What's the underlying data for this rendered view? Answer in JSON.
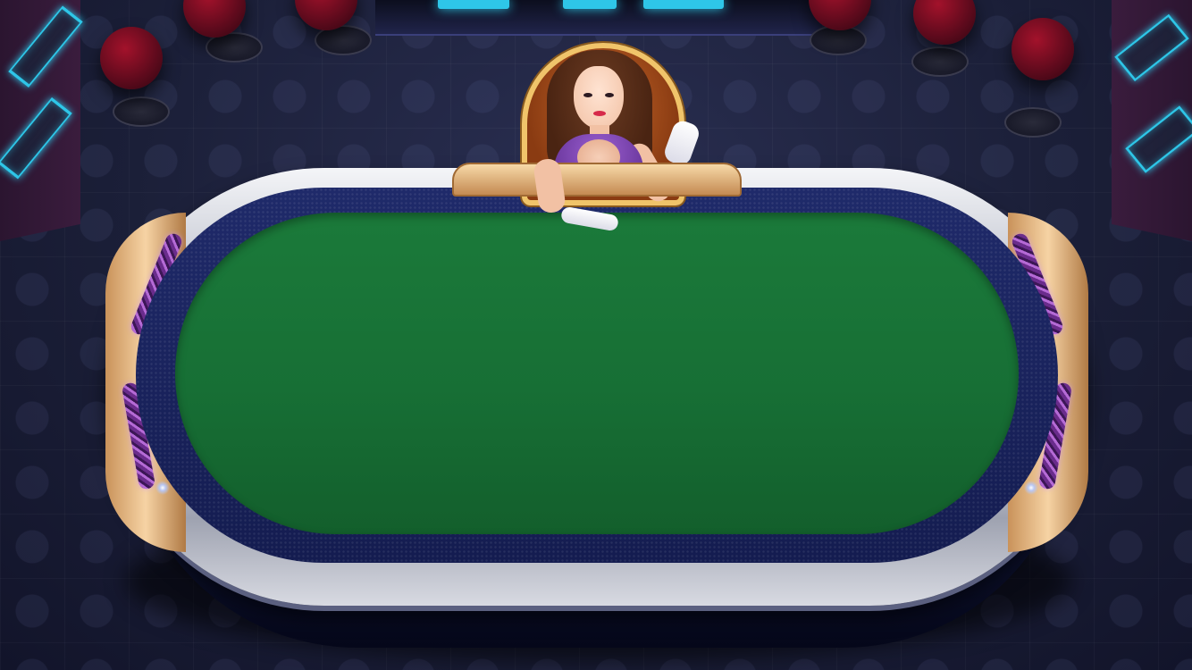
{
  "scene": {
    "type": "poker-table-lobby",
    "table": {
      "shape": "oval",
      "felt_color": "#176f35",
      "rail_color": "#c9ccd6",
      "trim_color": "#e6b47a",
      "gem_color": "#8a3fb0"
    },
    "dealer": {
      "present": true,
      "dress_color": "#6b36a6",
      "chair_color": "#a04a1a",
      "chair_trim_color": "#f0c46a"
    },
    "background": {
      "floor_color": "#1f233f",
      "neon_accent_color": "#2ec6e8",
      "stool_color": "#8a1027"
    }
  }
}
